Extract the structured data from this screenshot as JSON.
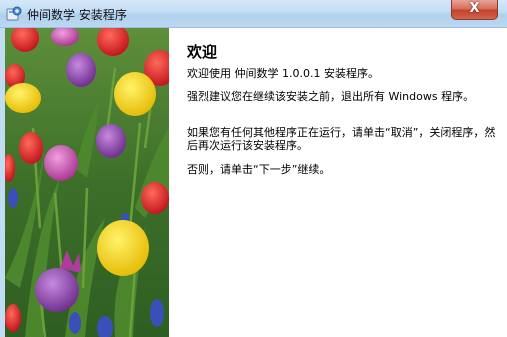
{
  "window": {
    "title": "仲间数学 安装程序",
    "close_label": "X"
  },
  "icons": {
    "app": "installer-icon",
    "close": "close-icon"
  },
  "content": {
    "heading": "欢迎",
    "paragraph1": "欢迎使用 仲间数学 1.0.0.1 安装程序。",
    "paragraph2": "强烈建议您在继续该安装之前，退出所有 Windows 程序。",
    "paragraph3": "如果您有任何其他程序正在运行，请单击“取消”，关闭程序，然后再次运行该安装程序。",
    "paragraph4": "否则，请单击“下一步”继续。"
  },
  "colors": {
    "titlebar": "#c1dcf3",
    "close_button": "#c4412a",
    "banner_foliage": "#3f7a2c"
  }
}
